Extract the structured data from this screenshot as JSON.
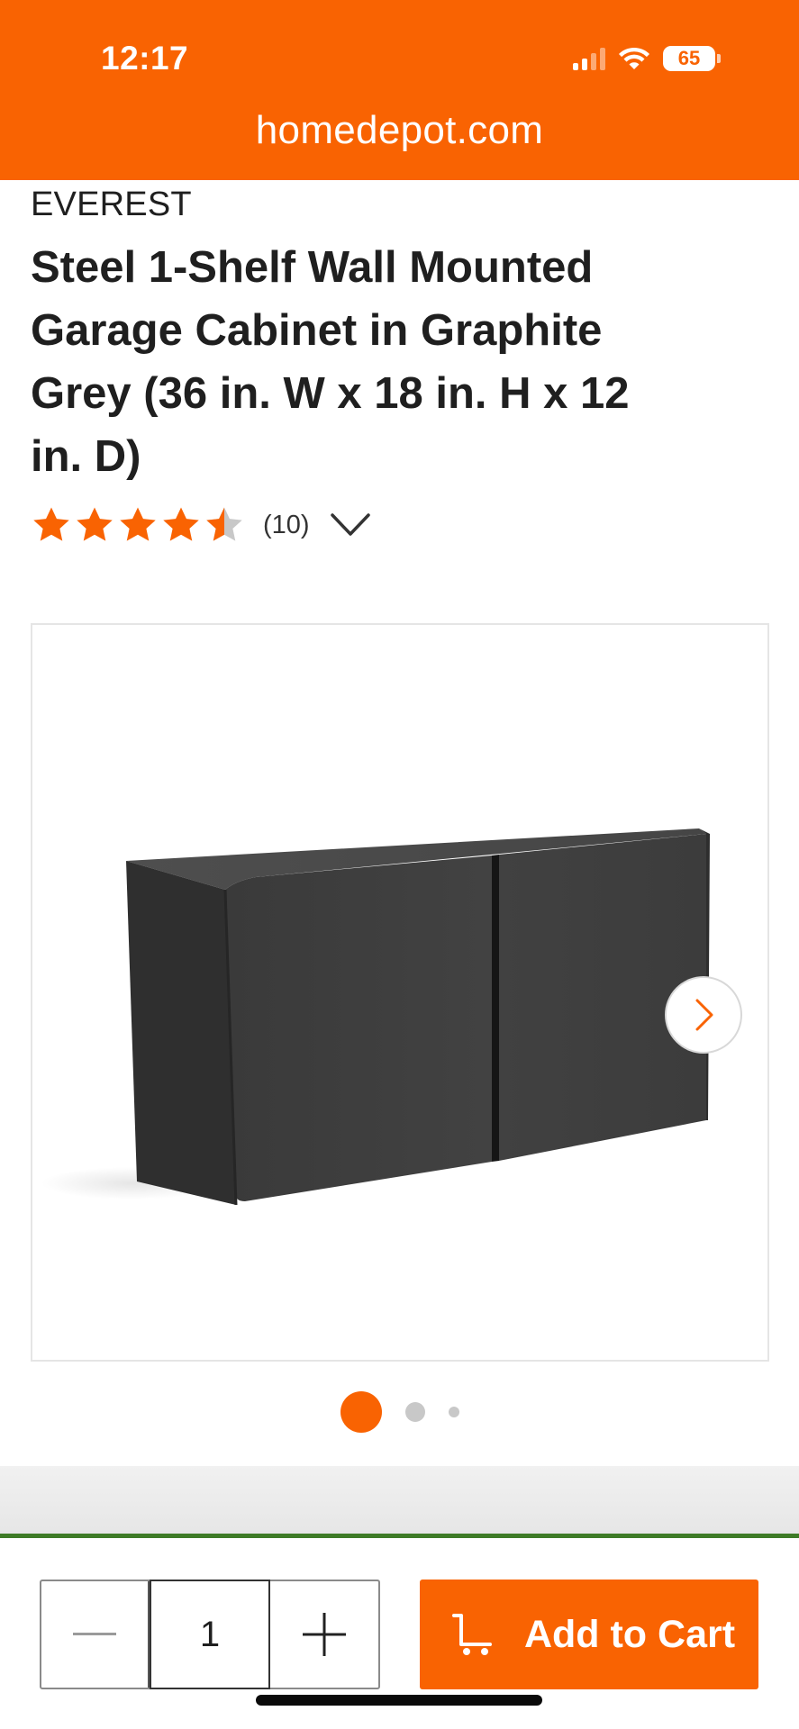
{
  "status_bar": {
    "time": "12:17",
    "battery": "65"
  },
  "browser": {
    "url": "homedepot.com"
  },
  "product": {
    "brand": "EVEREST",
    "title": "Steel 1-Shelf Wall Mounted Garage Cabinet in Graphite Grey (36 in. W x 18 in. H x 12 in. D)",
    "rating": 4.5,
    "rating_max": 5,
    "review_count": "(10)"
  },
  "gallery": {
    "image_icon": "cabinet-product-image",
    "next_icon": "chevron-right-icon",
    "current_index": 1,
    "total_dots": 3
  },
  "cart_bar": {
    "quantity": "1",
    "minus_icon": "minus-icon",
    "plus_icon": "plus-icon",
    "add_to_cart_label": "Add to Cart",
    "cart_icon": "cart-icon"
  },
  "colors": {
    "brand_orange": "#f96302",
    "accent_green": "#3e7b27",
    "star_color": "#f96302",
    "star_empty": "#c8c8c8"
  }
}
